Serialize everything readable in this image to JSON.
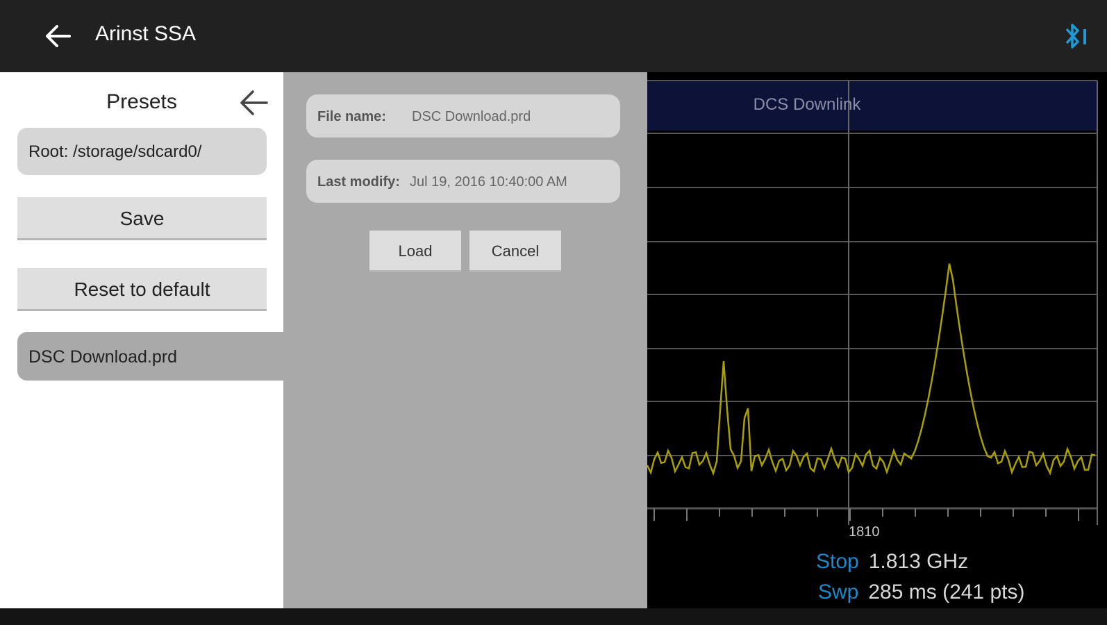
{
  "appbar": {
    "title": "Arinst SSA",
    "back_icon": "arrow-left-icon",
    "bluetooth_icon": "bluetooth-icon"
  },
  "presets": {
    "title": "Presets",
    "root_path": "Root: /storage/sdcard0/",
    "save_label": "Save",
    "reset_label": "Reset to default",
    "files": [
      "DSC Download.prd"
    ]
  },
  "dialog": {
    "file_name_label": "File name:",
    "file_name_value": "DSC Download.prd",
    "last_modify_label": "Last modify:",
    "last_modify_value": "Jul 19, 2016 10:40:00 AM",
    "load_label": "Load",
    "cancel_label": "Cancel"
  },
  "chart": {
    "band_label": "DCS Downlink",
    "center_tick": "1810",
    "stop_key": "Stop",
    "stop_value": "1.813 GHz",
    "swp_key": "Swp",
    "swp_value": "285 ms (241 pts)",
    "trace_color": "#a8a000",
    "band_color": "#0d1238"
  }
}
